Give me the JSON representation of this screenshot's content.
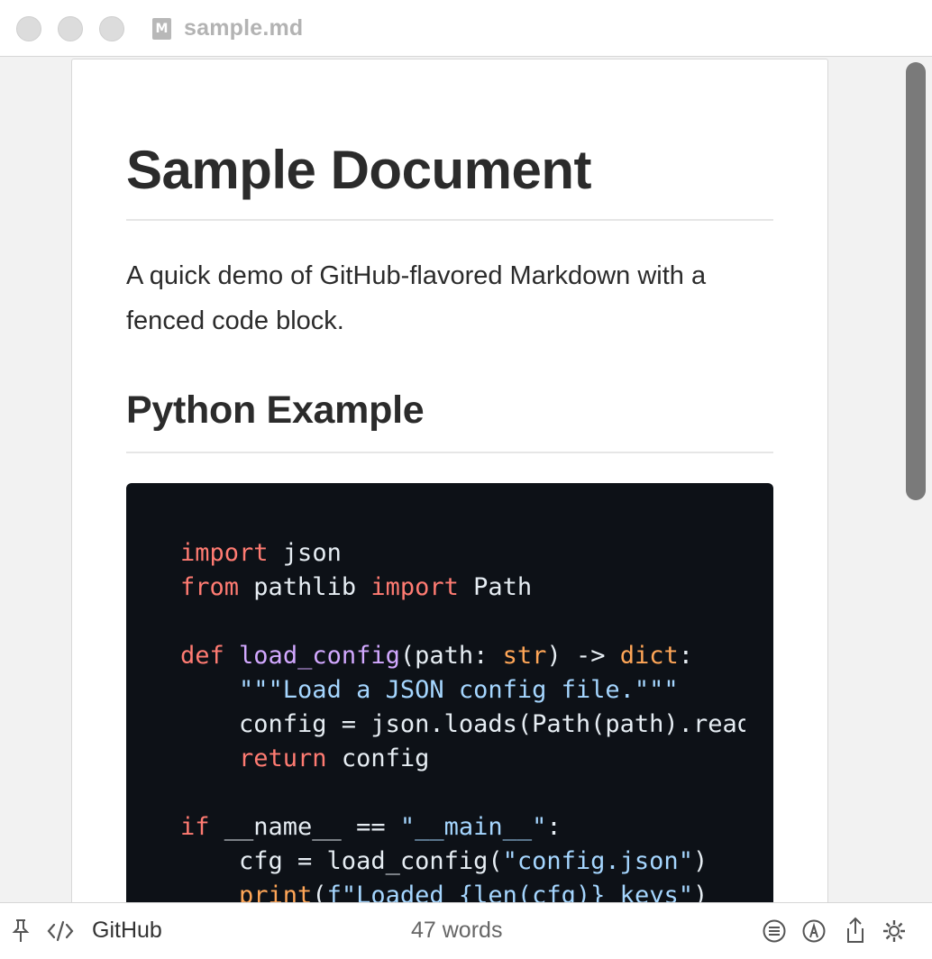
{
  "window": {
    "filename": "sample.md",
    "file_icon_glyph": "M",
    "file_icon": "markdown-file-icon"
  },
  "document": {
    "heading": "Sample Document",
    "paragraph": "A quick demo of GitHub-flavored Markdown with a fenced code block.",
    "subheading": "Python Example",
    "code_language": "python",
    "code_lines": [
      "import json",
      "from pathlib import Path",
      "",
      "def load_config(path: str) -> dict:",
      "    \"\"\"Load a JSON config file.\"\"\"",
      "    config = json.loads(Path(path).read_text())",
      "    return config",
      "",
      "if __name__ == \"__main__\":",
      "    cfg = load_config(\"config.json\")",
      "    print(f\"Loaded {len(cfg)} keys\")"
    ]
  },
  "statusbar": {
    "theme_label": "GitHub",
    "word_count": "47 words",
    "icons": [
      "pin-icon",
      "code-icon",
      "outline-icon",
      "style-icon",
      "share-icon",
      "settings-icon"
    ]
  },
  "colors": {
    "code_background": "#0d1117",
    "keyword": "#ff7b72",
    "function": "#d2a8ff",
    "builtin": "#ffa657",
    "string": "#a5d6ff",
    "code_text": "#e6edf3"
  }
}
